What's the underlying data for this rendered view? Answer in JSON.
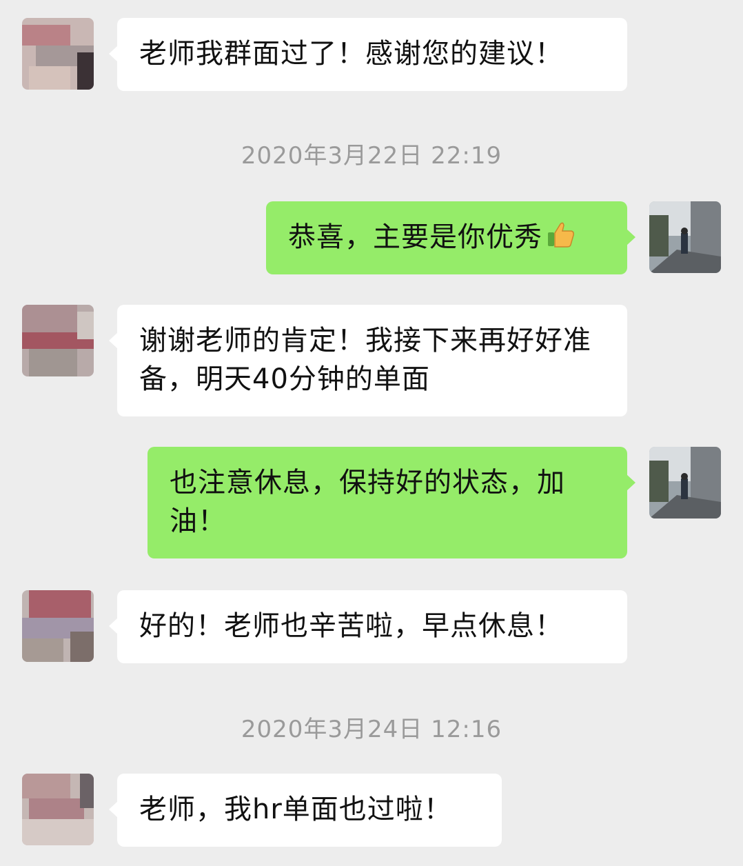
{
  "messages": [
    {
      "side": "in",
      "text": "老师我群面过了！感谢您的建议！"
    },
    {
      "side": "time",
      "text": "2020年3月22日 22:19"
    },
    {
      "side": "out",
      "text": "恭喜，主要是你优秀",
      "emoji": "thumbs-up"
    },
    {
      "side": "in",
      "text": "谢谢老师的肯定！我接下来再好好准备，明天40分钟的单面"
    },
    {
      "side": "out",
      "text": "也注意休息，保持好的状态，加油！"
    },
    {
      "side": "in",
      "text": "好的！老师也辛苦啦，早点休息！"
    },
    {
      "side": "time",
      "text": "2020年3月24日 12:16"
    },
    {
      "side": "in",
      "text": "老师，我hr单面也过啦！"
    }
  ],
  "colors": {
    "background": "#ededed",
    "incoming_bubble": "#ffffff",
    "outgoing_bubble": "#95ec69",
    "timestamp": "#9a9a9a"
  }
}
